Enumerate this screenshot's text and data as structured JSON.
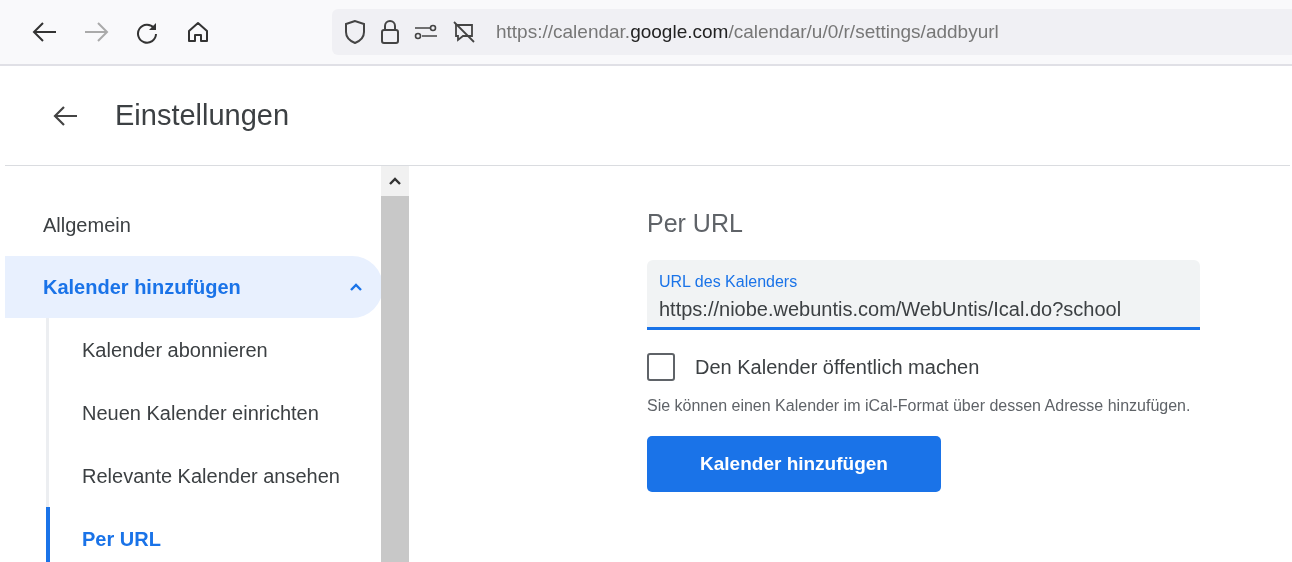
{
  "browser": {
    "back_disabled": false,
    "forward_disabled": true,
    "url": [
      {
        "text": "https://calendar.",
        "emphasis": false
      },
      {
        "text": "google.com",
        "emphasis": true
      },
      {
        "text": "/calendar/u/0/r/settings/addbyurl",
        "emphasis": false
      }
    ]
  },
  "header": {
    "title": "Einstellungen"
  },
  "sidebar": {
    "items": [
      {
        "label": "Allgemein",
        "selected": false
      },
      {
        "label": "Kalender hinzufügen",
        "selected": true,
        "expanded": true,
        "children": [
          {
            "label": "Kalender abonnieren",
            "selected": false
          },
          {
            "label": "Neuen Kalender einrichten",
            "selected": false
          },
          {
            "label": "Relevante Kalender ansehen",
            "selected": false
          },
          {
            "label": "Per URL",
            "selected": true
          }
        ]
      }
    ]
  },
  "form": {
    "title": "Per URL",
    "url_field": {
      "label": "URL des Kalenders",
      "value": "https://niobe.webuntis.com/WebUntis/Ical.do?school"
    },
    "public_checkbox": {
      "label": "Den Kalender öffentlich machen",
      "checked": false
    },
    "hint": "Sie können einen Kalender im iCal-Format über dessen Adresse hinzufügen.",
    "submit": "Kalender hinzufügen"
  }
}
